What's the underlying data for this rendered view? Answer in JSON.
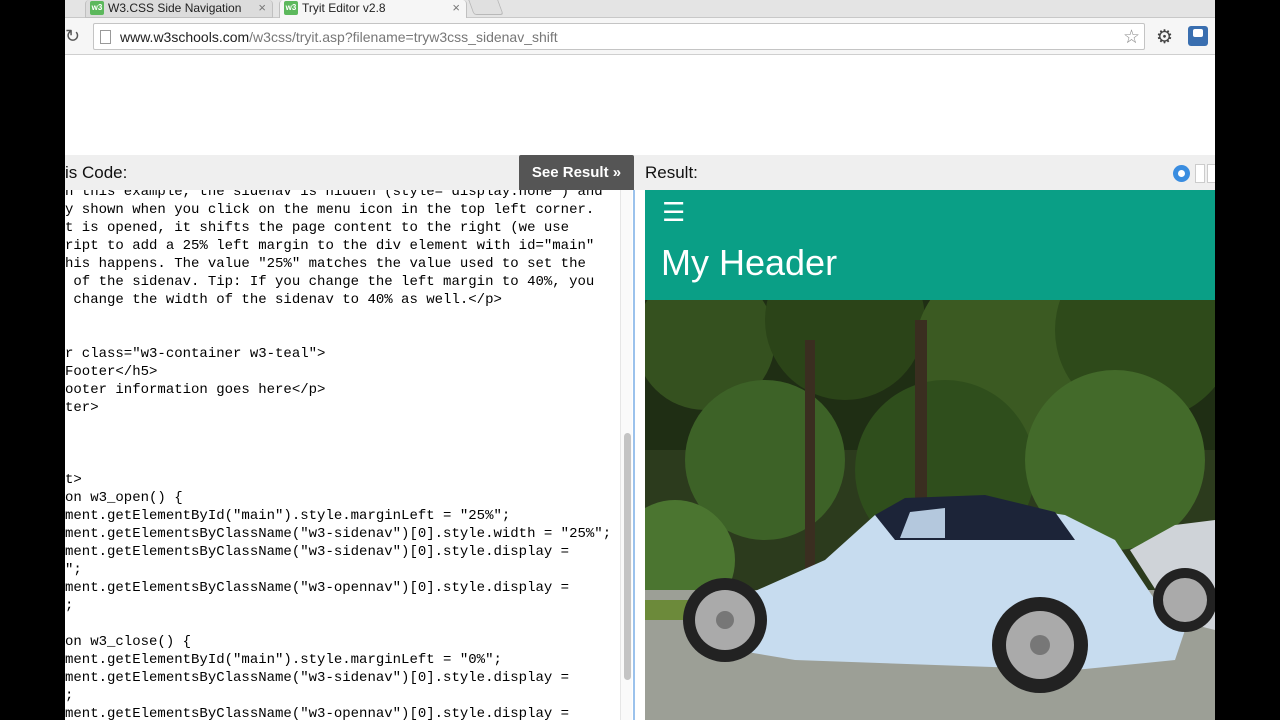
{
  "browser": {
    "tabs": [
      {
        "title": "W3.CSS Side Navigation",
        "active": false,
        "favicon": "w3"
      },
      {
        "title": "Tryit Editor v2.8",
        "active": true,
        "favicon": "w3"
      }
    ],
    "url_host": "www.w3schools.com",
    "url_path": "/w3css/tryit.asp?filename=tryw3css_sidenav_shift",
    "icons": [
      "reload-icon",
      "page-icon",
      "bookmark-star-icon",
      "gear-icon",
      "extension-icon",
      "close-icon",
      "menu-icon"
    ]
  },
  "editor": {
    "code_label": "is Code:",
    "see_result_label": "See Result »",
    "result_label": "Result:",
    "code_lines": [
      "n this example, the sidenav is hidden (style=\"display:none\") and",
      "y shown when you click on the menu icon in the top left corner.",
      "t is opened, it shifts the page content to the right (we use",
      "ript to add a 25% left margin to the div element with id=\"main\"",
      "his happens. The value \"25%\" matches the value used to set the",
      " of the sidenav. Tip: If you change the left margin to 40%, you",
      " change the width of the sidenav to 40% as well.</p>",
      "",
      "",
      "r class=\"w3-container w3-teal\">",
      "Footer</h5>",
      "ooter information goes here</p>",
      "ter>",
      "",
      "",
      "",
      "t>",
      "on w3_open() {",
      "ment.getElementById(\"main\").style.marginLeft = \"25%\";",
      "ment.getElementsByClassName(\"w3-sidenav\")[0].style.width = \"25%\";",
      "ment.getElementsByClassName(\"w3-sidenav\")[0].style.display =",
      "\";",
      "ment.getElementsByClassName(\"w3-opennav\")[0].style.display =",
      ";",
      "",
      "on w3_close() {",
      "ment.getElementById(\"main\").style.marginLeft = \"0%\";",
      "ment.getElementsByClassName(\"w3-sidenav\")[0].style.display =",
      ";",
      "ment.getElementsByClassName(\"w3-opennav\")[0].style.display ="
    ]
  },
  "result": {
    "header_title": "My Header",
    "header_color": "#0a9f86"
  }
}
